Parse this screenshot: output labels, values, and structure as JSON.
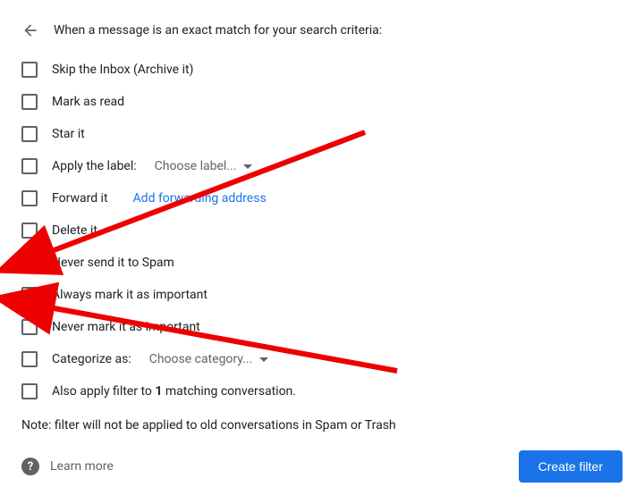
{
  "header": {
    "title": "When a message is an exact match for your search criteria:"
  },
  "options": {
    "skip_inbox": {
      "label": "Skip the Inbox (Archive it)",
      "checked": false
    },
    "mark_read": {
      "label": "Mark as read",
      "checked": false
    },
    "star": {
      "label": "Star it",
      "checked": false
    },
    "apply_label": {
      "label": "Apply the label:",
      "dropdown": "Choose label...",
      "checked": false
    },
    "forward": {
      "label": "Forward it",
      "link": "Add forwarding address",
      "checked": false
    },
    "delete": {
      "label": "Delete it",
      "checked": false
    },
    "never_spam": {
      "label": "Never send it to Spam",
      "checked": true
    },
    "mark_important": {
      "label": "Always mark it as important",
      "checked": true
    },
    "never_important": {
      "label": "Never mark it as important",
      "checked": false
    },
    "categorize": {
      "label": "Categorize as:",
      "dropdown": "Choose category...",
      "checked": false
    },
    "also_apply": {
      "prefix": "Also apply filter to ",
      "count": "1",
      "suffix": " matching conversation.",
      "checked": false
    }
  },
  "note": "Note: filter will not be applied to old conversations in Spam or Trash",
  "footer": {
    "learn_more": "Learn more",
    "create": "Create filter"
  }
}
